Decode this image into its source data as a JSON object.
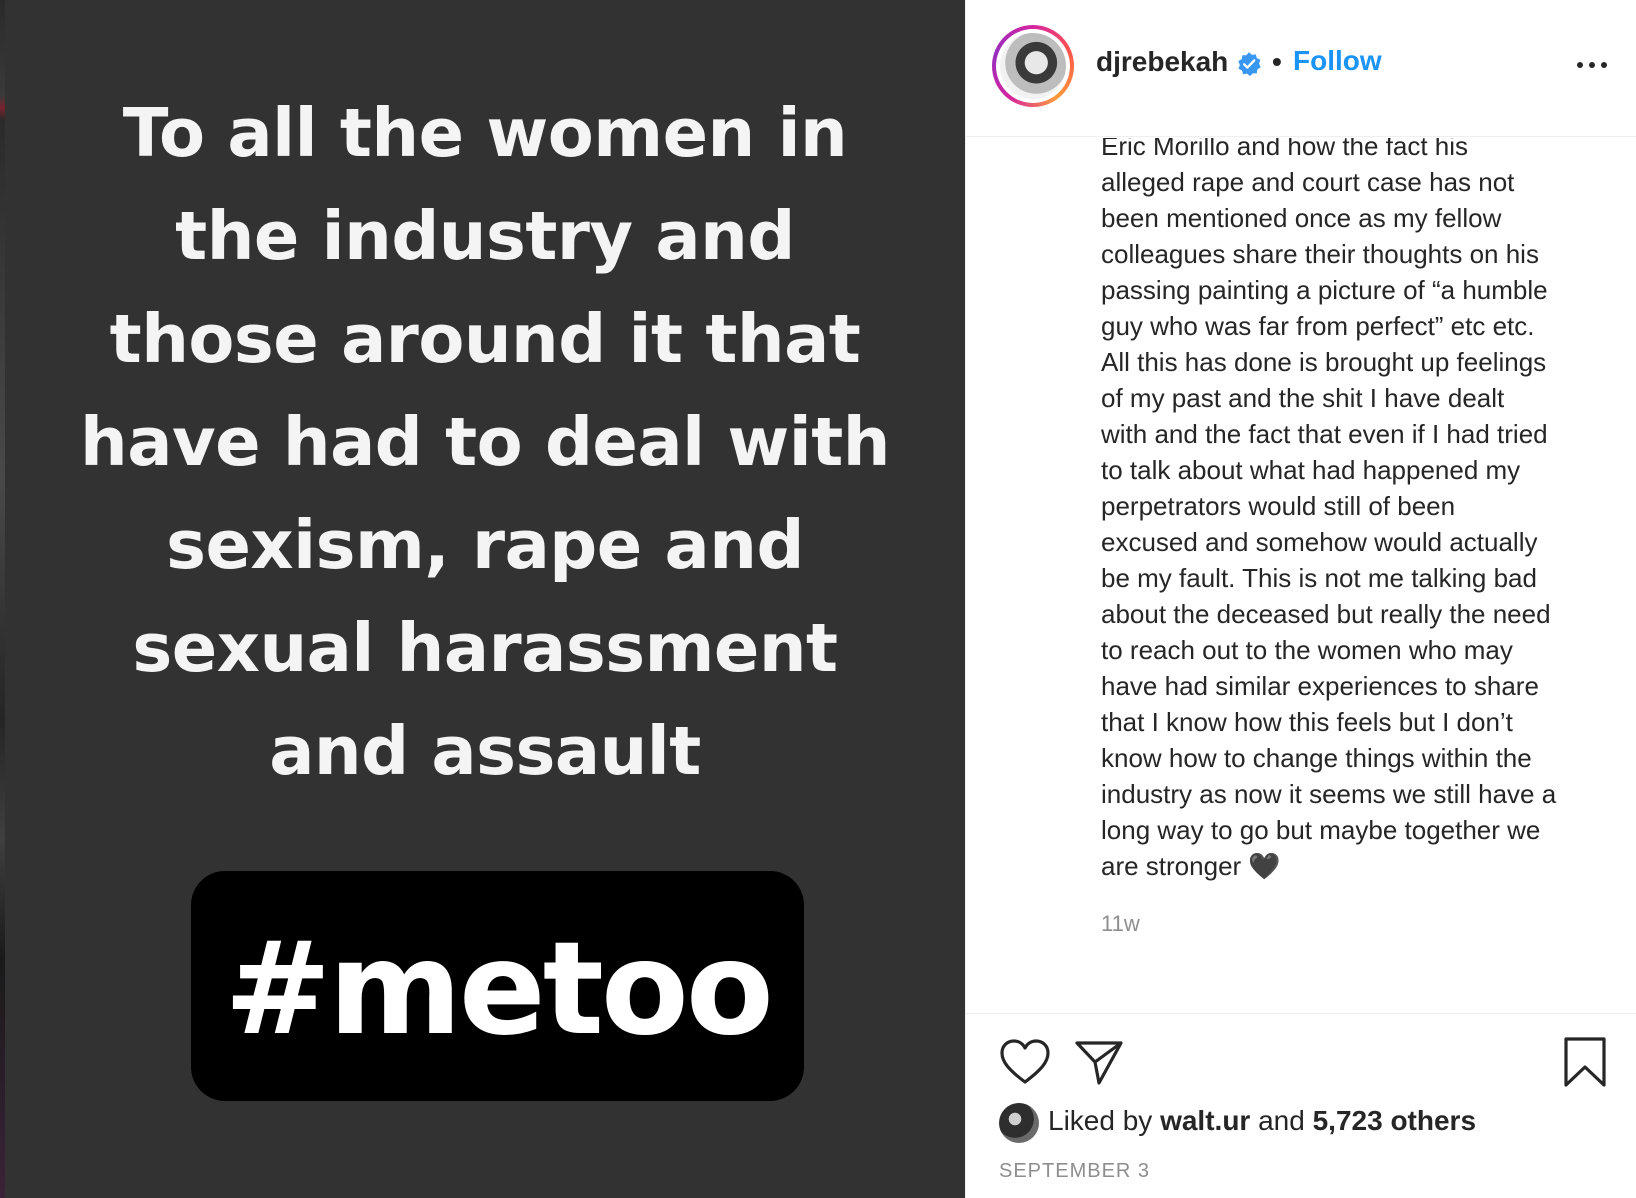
{
  "media": {
    "lines": [
      "To all the women in",
      "the industry and",
      "those around it that",
      "have had to deal with",
      "sexism, rape and",
      "sexual harassment",
      "and assault"
    ],
    "hashtag": "#metoo"
  },
  "header": {
    "username": "djrebekah",
    "separator": "•",
    "follow_label": "Follow"
  },
  "caption": {
    "text": "Eric Morillo and how the fact his\nalleged rape and court case has not\nbeen mentioned once as my fellow\ncolleagues share their thoughts on his\npassing painting a picture of “a humble\nguy who was far from perfect” etc etc.\nAll this has done is brought up feelings\nof my past and the shit I have dealt\nwith and the fact that even if I had tried\nto talk about what had happened my\nperpetrators would still of been\nexcused and somehow would actually\nbe my fault. This is not me talking bad\nabout the deceased but really the need\nto reach out to the women who may\nhave had similar experiences to share\nthat I know how this feels but I don’t\nknow how to change things within the\nindustry as now it seems we still have a\nlong way to go but maybe together we\nare stronger 🖤",
    "time_ago": "11w"
  },
  "likes": {
    "prefix": "Liked by ",
    "user": "walt.ur",
    "middle": " and ",
    "others": "5,723 others"
  },
  "date": "SEPTEMBER 3",
  "icons": {
    "heart": "heart-icon",
    "share": "share-icon",
    "save": "bookmark-icon",
    "more": "more-options-icon",
    "verified": "verified-badge-icon"
  },
  "colors": {
    "accent": "#1a94f6",
    "media_bg": "#323232",
    "text": "#262626",
    "muted": "#8e8e8e"
  }
}
